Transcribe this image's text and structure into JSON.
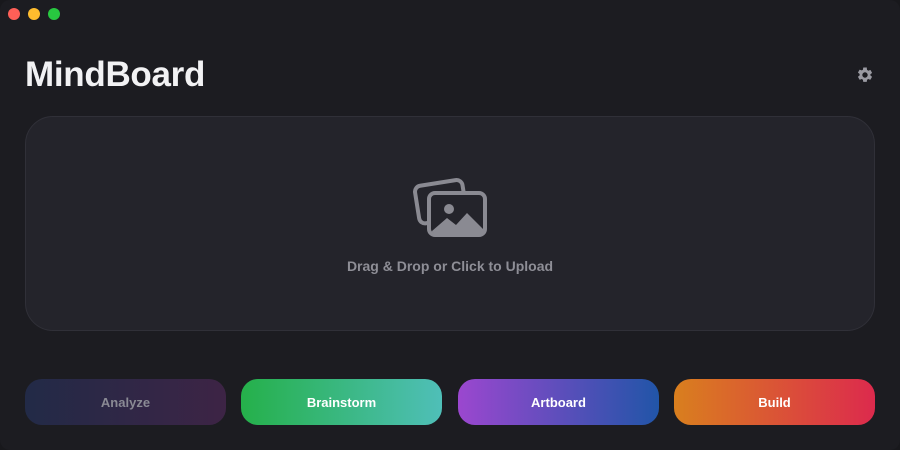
{
  "app": {
    "title": "MindBoard"
  },
  "window_controls": {
    "close_color": "#fe5f57",
    "minimize_color": "#febc2e",
    "maximize_color": "#28c840"
  },
  "header": {
    "settings_icon": "gear-icon"
  },
  "dropzone": {
    "icon": "images-icon",
    "text": "Drag & Drop or Click to Upload"
  },
  "actions": {
    "analyze": {
      "label": "Analyze",
      "gradient": [
        "#222a47",
        "#3d2445"
      ]
    },
    "brainstorm": {
      "label": "Brainstorm",
      "gradient": [
        "#25b04a",
        "#4fbfb8"
      ]
    },
    "artboard": {
      "label": "Artboard",
      "gradient": [
        "#9b47cf",
        "#2155a8"
      ]
    },
    "build": {
      "label": "Build",
      "gradient": [
        "#d97f1e",
        "#dc2a4d"
      ]
    }
  }
}
